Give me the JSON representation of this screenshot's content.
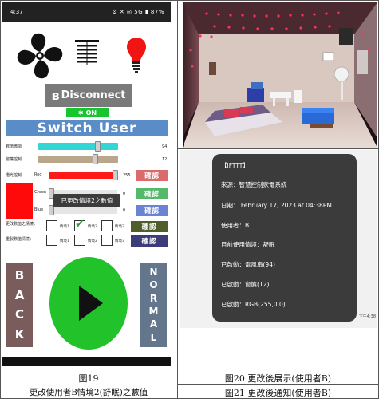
{
  "status_bar": {
    "time": "4:37",
    "indicators": "⚙ ✕ ◎ 5G ▮ 87%"
  },
  "app": {
    "icons": [
      "fan-icon",
      "blinds-icon",
      "bulb-icon"
    ],
    "disconnect_label": "Disconnect",
    "bluetooth_symbol": "ʙ",
    "connection_status": "ON",
    "switch_user_label": "Switch User",
    "sliders": [
      {
        "label": "數值微調",
        "value": "94",
        "fill": 0.94,
        "color": "#32d6d6"
      },
      {
        "label": "窗簾控制",
        "value": "12",
        "fill": 0.62,
        "color": "#b9a78b"
      }
    ],
    "rgb": {
      "section_label": "燈光控制",
      "channels": [
        {
          "label": "Red",
          "value": "255",
          "fill": 1.0,
          "color": "#ff1a1a"
        },
        {
          "label": "Green",
          "value": "0",
          "fill": 0.0,
          "color": "#2fc24a"
        },
        {
          "label": "Blue",
          "value": "0",
          "fill": 0.0,
          "color": "#4b68d6"
        }
      ],
      "confirm_label": "確認",
      "confirm_colors": [
        "#d96b6b",
        "#55b96c",
        "#6a84d4"
      ]
    },
    "tooltip": "已更改情境2之數值",
    "change_row": {
      "label": "更改數值之情境：",
      "options": [
        "情境1",
        "情境2",
        "情境3"
      ],
      "checked_index": 1,
      "confirm_label": "確認",
      "confirm_color": "#4f5e2b"
    },
    "restore_row": {
      "label": "重製數值情境：",
      "options": [
        "情境1",
        "情境2",
        "情境3"
      ],
      "confirm_label": "確認",
      "confirm_color": "#3c3c78"
    },
    "back_label": [
      "B",
      "A",
      "C",
      "K"
    ],
    "normal_label": [
      "N",
      "O",
      "R",
      "M",
      "A",
      "L"
    ]
  },
  "notification": {
    "title": "【IFTTT】",
    "source": "來源：智慧控制家電系統",
    "date": "日期： February 17, 2023 at 04:38PM",
    "user": "使用者：B",
    "scene": "目前使用情境：舒眠",
    "fan": "已啟動：電風扇(94)",
    "curtain": "已啟動：窗簾(12)",
    "rgb": "已啟動：RGB(255,0,0)",
    "timestamp": "下午4:38"
  },
  "captions": {
    "fig19": "圖19",
    "fig19_desc": "更改使用者B情境2(舒眠)之數值",
    "fig20": "圖20 更改後展示(使用者B)",
    "fig21": "圖21 更改後通知(使用者B)"
  }
}
